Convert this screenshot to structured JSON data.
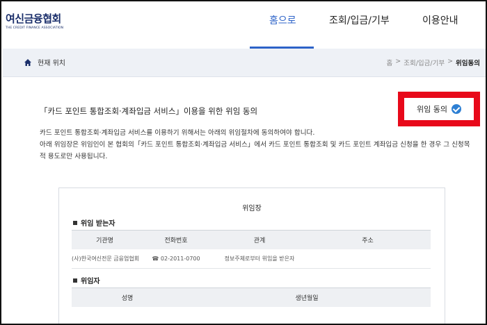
{
  "header": {
    "logo_main": "여신금융협회",
    "logo_sub": "THE CREDIT FINANCE ASSOCIATION",
    "nav": [
      {
        "label": "홈으로",
        "active": true
      },
      {
        "label": "조회/입금/기부",
        "active": false
      },
      {
        "label": "이용안내",
        "active": false
      }
    ]
  },
  "breadcrumb": {
    "label": "현재 위치",
    "path": [
      "홈",
      "조회/입금/기부",
      "위임동의"
    ],
    "separator": ">"
  },
  "content": {
    "title": "「카드 포인트 통합조회·계좌입금 서비스」이용을 위한 위임 동의",
    "consent_label": "위임 동의",
    "para1": "카드 포인트 통합조회·계좌입금 서비스를 이용하기 위해서는 아래의 위임절차에 동의하여야 합니다.",
    "para2": "아래 위임장은 위임인이 본 협회의「카드 포인트 통합조회·계좌입금 서비스」에서 카드 포인트 통합조회 및 카드 포인트 계좌입금 신청을 한 경우 그 신청목적 용도로만 사용됩니다."
  },
  "document": {
    "title": "위임장",
    "section1": "위임 받는자",
    "table1": {
      "headers": [
        "기관명",
        "전화번호",
        "관계",
        "주소"
      ],
      "rows": [
        [
          "(사)한국여신전문 금융업협회",
          "☎ 02-2011-0700",
          "정보주체로부터 위임을 받은자",
          ""
        ]
      ]
    },
    "section2": "위임자",
    "table2": {
      "headers": [
        "성명",
        "생년월일"
      ]
    }
  },
  "colors": {
    "accent": "#2d63c8",
    "highlight": "#e8091a",
    "check": "#2d7fd3"
  }
}
